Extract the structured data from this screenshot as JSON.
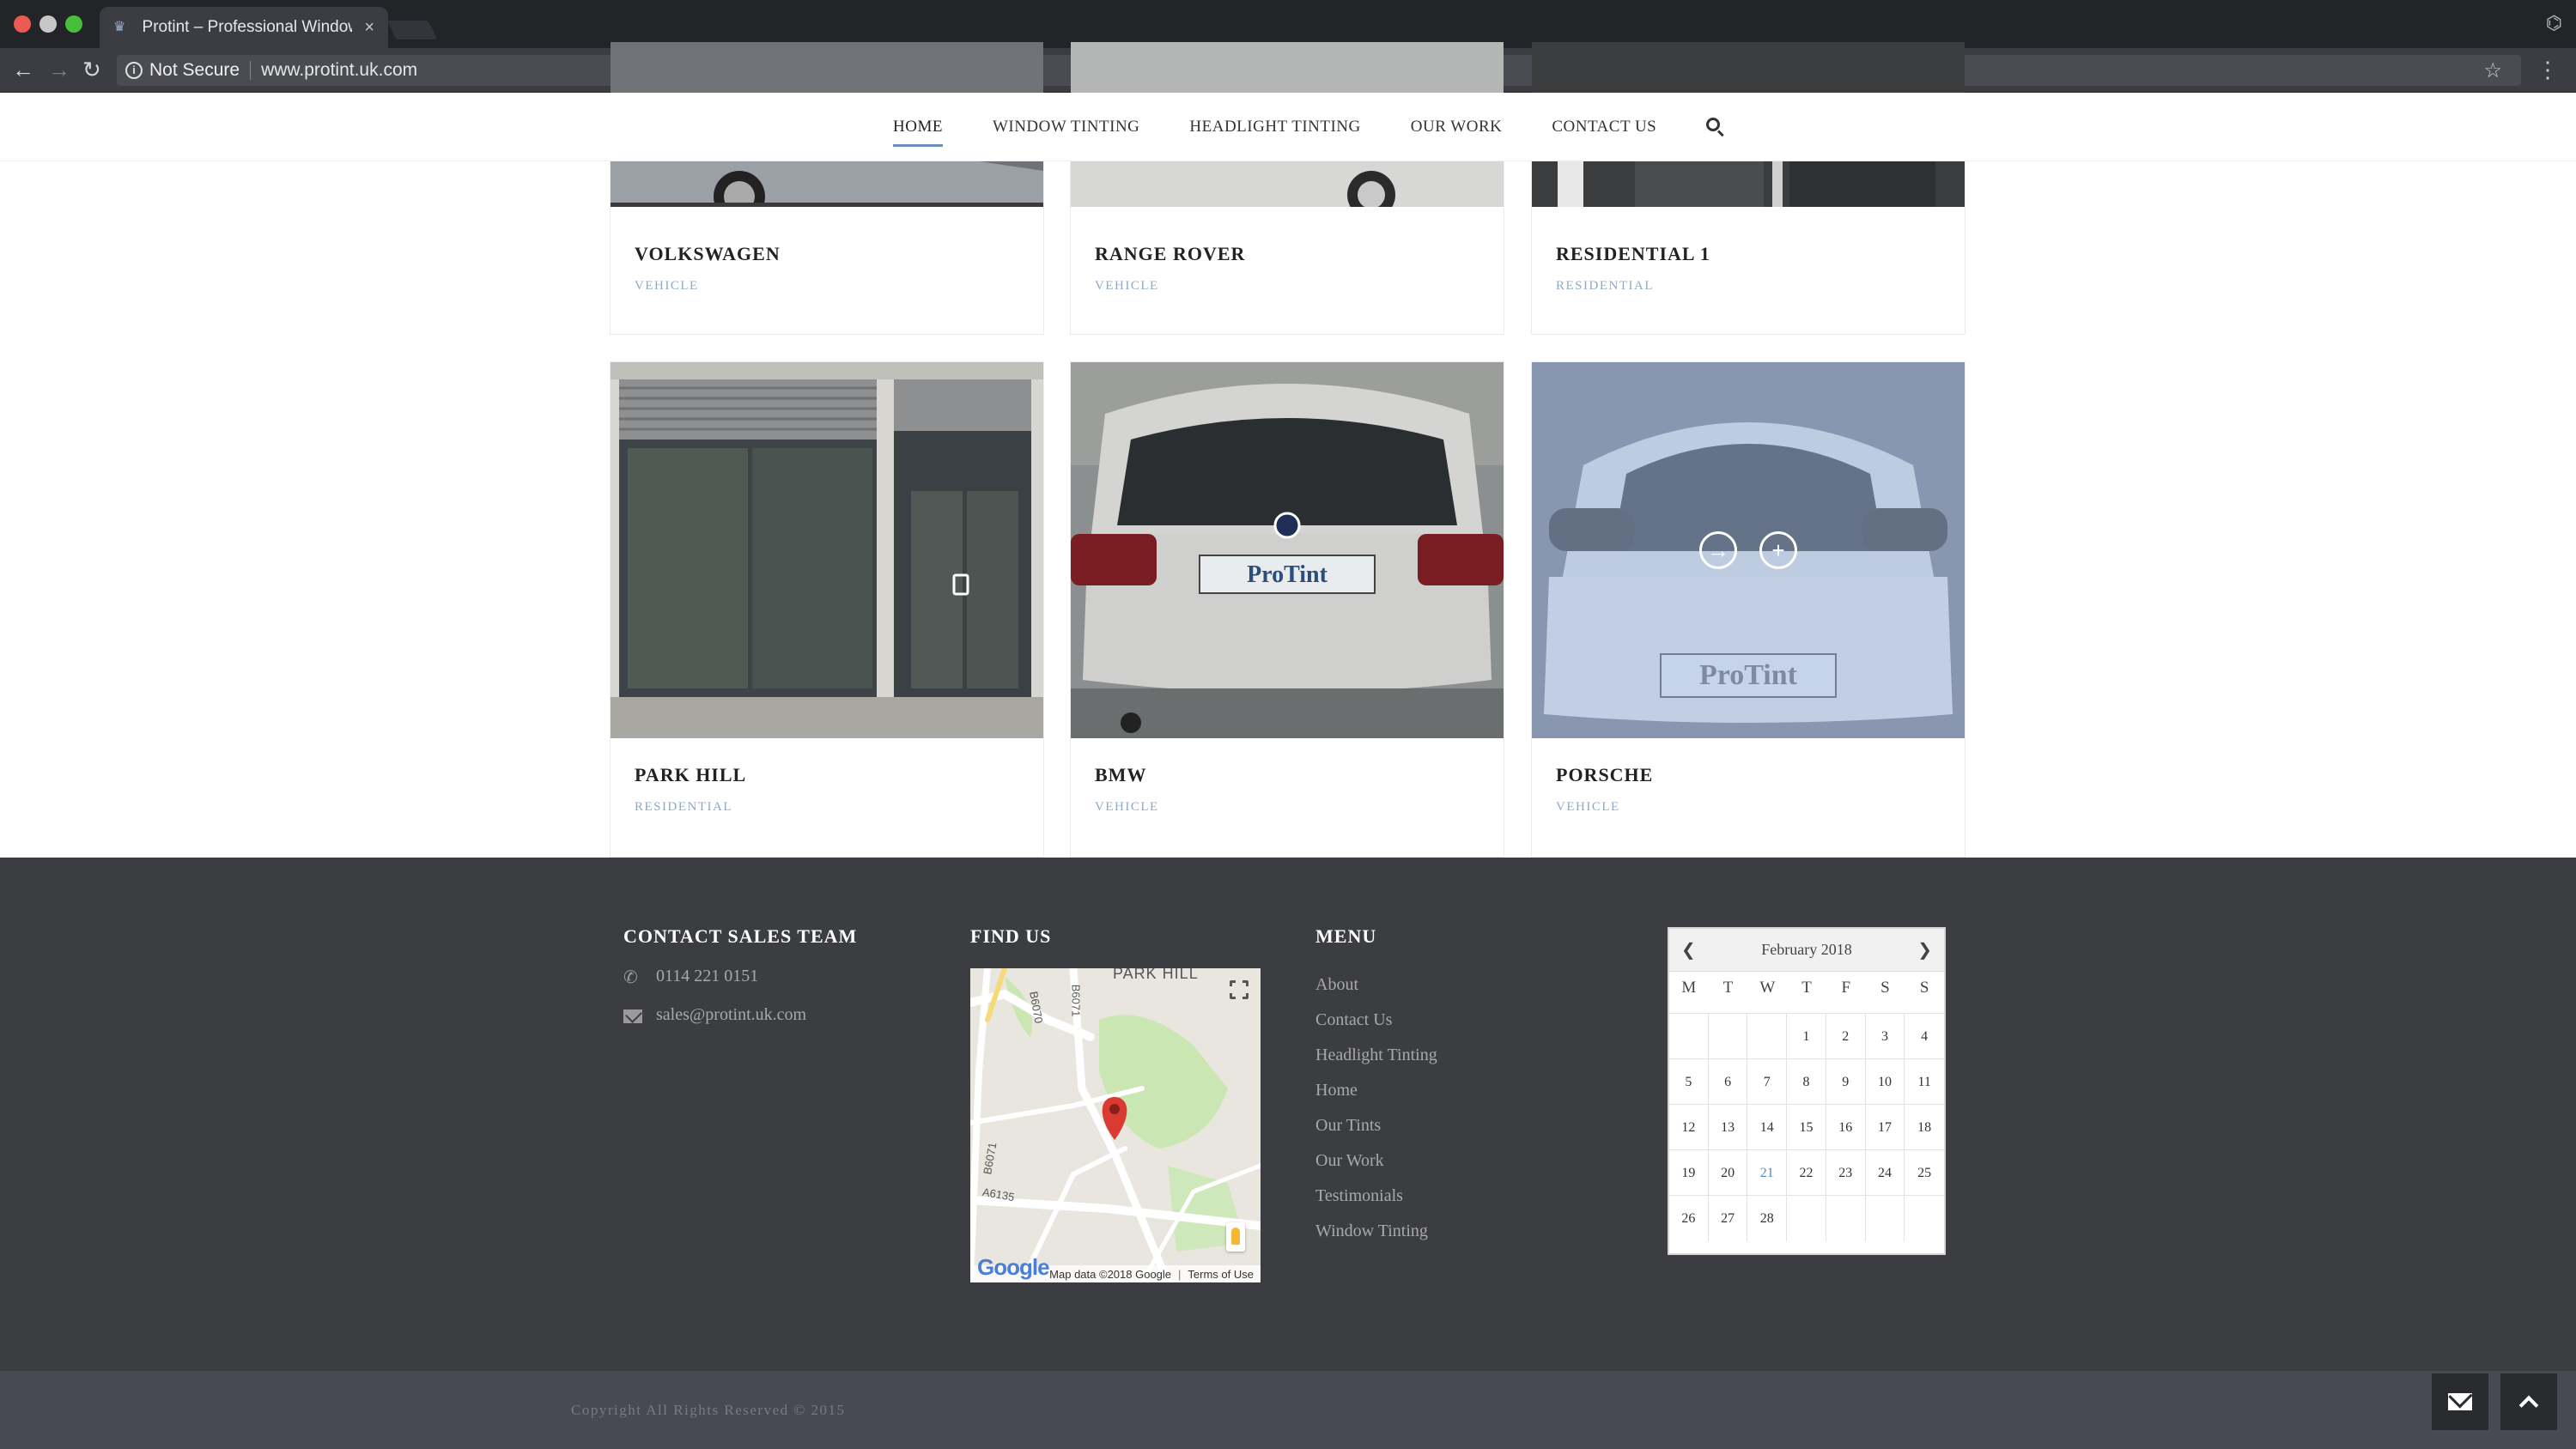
{
  "browser": {
    "tab_title": "Protint – Professional Window",
    "tab_close": "×",
    "security_label": "Not Secure",
    "url": "www.protint.uk.com"
  },
  "site_nav": {
    "items": [
      {
        "label": "HOME",
        "active": true
      },
      {
        "label": "WINDOW TINTING",
        "active": false
      },
      {
        "label": "HEADLIGHT TINTING",
        "active": false
      },
      {
        "label": "OUR WORK",
        "active": false
      },
      {
        "label": "CONTACT US",
        "active": false
      }
    ]
  },
  "portfolio": {
    "row1": [
      {
        "title": "VOLKSWAGEN",
        "category": "VEHICLE"
      },
      {
        "title": "RANGE ROVER",
        "category": "VEHICLE"
      },
      {
        "title": "RESIDENTIAL 1",
        "category": "RESIDENTIAL"
      }
    ],
    "row2": [
      {
        "title": "PARK HILL",
        "category": "RESIDENTIAL"
      },
      {
        "title": "BMW",
        "category": "VEHICLE",
        "plate": "ProTint"
      },
      {
        "title": "PORSCHE",
        "category": "VEHICLE",
        "plate": "ProTint"
      }
    ]
  },
  "footer": {
    "contact_heading": "CONTACT SALES TEAM",
    "phone": "0114 221 0151",
    "email": "sales@protint.uk.com",
    "find_us_heading": "FIND US",
    "map": {
      "area_label": "PARK HILL",
      "road_labels": [
        "B6070",
        "B6071",
        "B6071",
        "A6135"
      ],
      "attribution": "Map data ©2018 Google",
      "terms": "Terms of Use",
      "logo": "Google"
    },
    "menu_heading": "MENU",
    "menu_items": [
      "About",
      "Contact Us",
      "Headlight Tinting",
      "Home",
      "Our Tints",
      "Our Work",
      "Testimonials",
      "Window Tinting"
    ],
    "calendar": {
      "title": "February 2018",
      "weekdays": [
        "M",
        "T",
        "W",
        "T",
        "F",
        "S",
        "S"
      ],
      "weeks": [
        [
          "",
          "",
          "",
          "1",
          "2",
          "3",
          "4"
        ],
        [
          "5",
          "6",
          "7",
          "8",
          "9",
          "10",
          "11"
        ],
        [
          "12",
          "13",
          "14",
          "15",
          "16",
          "17",
          "18"
        ],
        [
          "19",
          "20",
          "21",
          "22",
          "23",
          "24",
          "25"
        ],
        [
          "26",
          "27",
          "28",
          "",
          "",
          "",
          ""
        ]
      ],
      "today": "21"
    },
    "copyright": "Copyright All Rights Reserved © 2015"
  },
  "icons": {
    "nav": "search-icon",
    "phone": "phone-icon",
    "email": "envelope-icon",
    "link": "arrow-circle-icon",
    "zoom": "plus-circle-icon",
    "fab_mail": "envelope-icon",
    "fab_top": "chevron-up-icon"
  },
  "colors": {
    "accent": "#6f8fb8",
    "category": "#8fa9c6",
    "footer_bg": "#3b3d41",
    "bottom_bar": "#474a53"
  }
}
